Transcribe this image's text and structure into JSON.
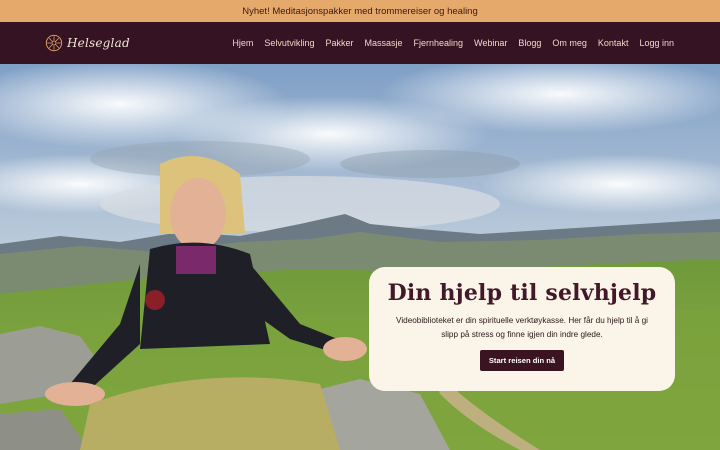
{
  "announcement": {
    "text": "Nyhet! Meditasjonspakker med trommereiser og healing"
  },
  "brand": {
    "name": "Helseglad"
  },
  "nav": {
    "items": [
      {
        "label": "Hjem"
      },
      {
        "label": "Selvutvikling"
      },
      {
        "label": "Pakker"
      },
      {
        "label": "Massasje"
      },
      {
        "label": "Fjernhealing"
      },
      {
        "label": "Webinar"
      },
      {
        "label": "Blogg"
      },
      {
        "label": "Om meg"
      },
      {
        "label": "Kontakt"
      },
      {
        "label": "Logg inn"
      }
    ]
  },
  "hero": {
    "title": "Din hjelp til selvhjelp",
    "description": "Videobiblioteket er din spirituelle verktøykasse. Her får du hjelp til å gi slipp på stress og finne igjen din indre glede.",
    "cta_label": "Start reisen din nå"
  },
  "colors": {
    "announcement_bg": "#e5a96c",
    "nav_bg": "#361322",
    "card_bg": "#fbf4e8",
    "title": "#43192a",
    "cta_bg": "#3a1420"
  }
}
